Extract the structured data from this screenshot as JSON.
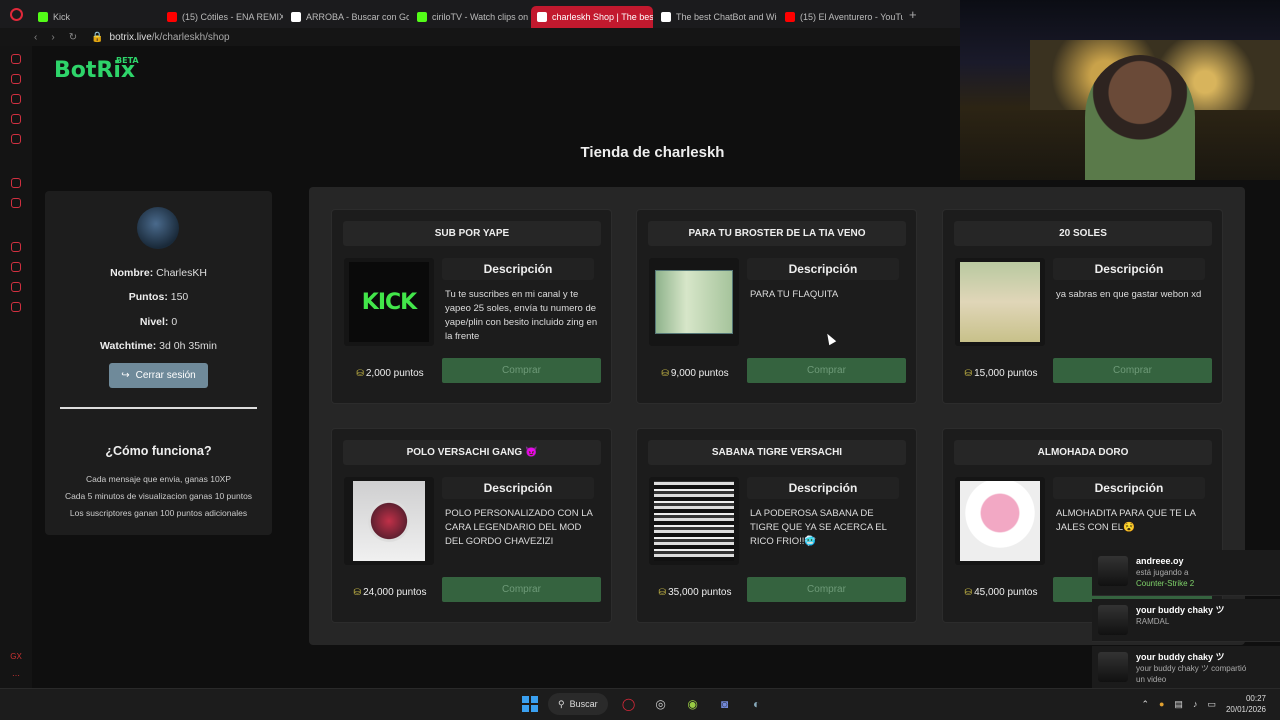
{
  "browser": {
    "tabs": [
      {
        "label": "Kick",
        "fav_color": "#53fc18",
        "active": false
      },
      {
        "label": "(15) Cótiles - ENA REMIX",
        "fav_color": "#ff0000",
        "active": false
      },
      {
        "label": "ARROBA - Buscar con Go",
        "fav_color": "#ffffff",
        "active": false
      },
      {
        "label": "ciriloTV - Watch clips on K",
        "fav_color": "#53fc18",
        "active": false
      },
      {
        "label": "charleskh Shop | The best",
        "fav_color": "#ffffff",
        "active": true
      },
      {
        "label": "The best ChatBot and Wid",
        "fav_color": "#ffffff",
        "active": false
      },
      {
        "label": "(15) El Aventurero - YouTub",
        "fav_color": "#ff0000",
        "active": false
      }
    ],
    "new_tab": "+",
    "url_host": "botrix.live",
    "url_path": "/k/charleskh/shop"
  },
  "logo": {
    "name": "BotRix",
    "badge": "BETA"
  },
  "page_title": "Tienda de charleskh",
  "profile": {
    "name_label": "Nombre:",
    "name_value": "CharlesKH",
    "points_label": "Puntos:",
    "points_value": "150",
    "level_label": "Nivel:",
    "level_value": "0",
    "watch_label": "Watchtime:",
    "watch_value": "3d 0h 35min",
    "logout_label": "Cerrar sesión",
    "how_title": "¿Cómo funciona?",
    "how_lines": [
      "Cada mensaje que envia, ganas 10XP",
      "Cada 5 minutos de visualizacion ganas 10 puntos",
      "Los suscriptores ganan 100 puntos adicionales"
    ]
  },
  "shop": {
    "desc_heading": "Descripción",
    "buy_label": "Comprar",
    "items": [
      {
        "title": "SUB POR YAPE",
        "desc": "Tu te suscribes en mi canal y te yapeo 25 soles, envía tu numero de yape/plin con besito incluido zing en la frente",
        "price": "2,000 puntos",
        "thumb": "kick",
        "thumb_text": "KICK"
      },
      {
        "title": "PARA TU BROSTER DE LA TIA VENO",
        "desc": "PARA TU FLAQUITA",
        "price": "9,000 puntos",
        "thumb": "money"
      },
      {
        "title": "20 SOLES",
        "desc": "ya sabras en que gastar webon xd",
        "price": "15,000 puntos",
        "thumb": "money2"
      },
      {
        "title": "POLO VERSACHI GANG 😈",
        "desc": "POLO PERSONALIZADO CON LA CARA LEGENDARIO DEL MOD DEL GORDO CHAVEZIZI",
        "price": "24,000 puntos",
        "thumb": "shirt"
      },
      {
        "title": "SABANA TIGRE VERSACHI",
        "desc": "LA PODEROSA SABANA DE TIGRE QUE YA SE ACERCA EL RICO FRIO!!🥶",
        "price": "35,000 puntos",
        "thumb": "tiger"
      },
      {
        "title": "ALMOHADA DORO",
        "desc": "ALMOHADITA PARA QUE TE LA JALES CON EL😵",
        "price": "45,000 puntos",
        "thumb": "pillow"
      }
    ]
  },
  "notifications": [
    {
      "name": "andreee.oy",
      "line1": "está jugando a",
      "line2": "Counter-Strike 2"
    },
    {
      "name": "your buddy chaky ツ",
      "line1": "RAMDAL",
      "line2": ""
    },
    {
      "name": "your buddy chaky ツ",
      "line1": "your buddy chaky ツ compartió",
      "line2": "un video"
    }
  ],
  "taskbar": {
    "search_label": "Buscar",
    "time": "00:27",
    "date": "20/01/2026"
  },
  "colors": {
    "accent": "#2ed46a",
    "buy": "#35633f",
    "tab_active": "#c2192e"
  }
}
